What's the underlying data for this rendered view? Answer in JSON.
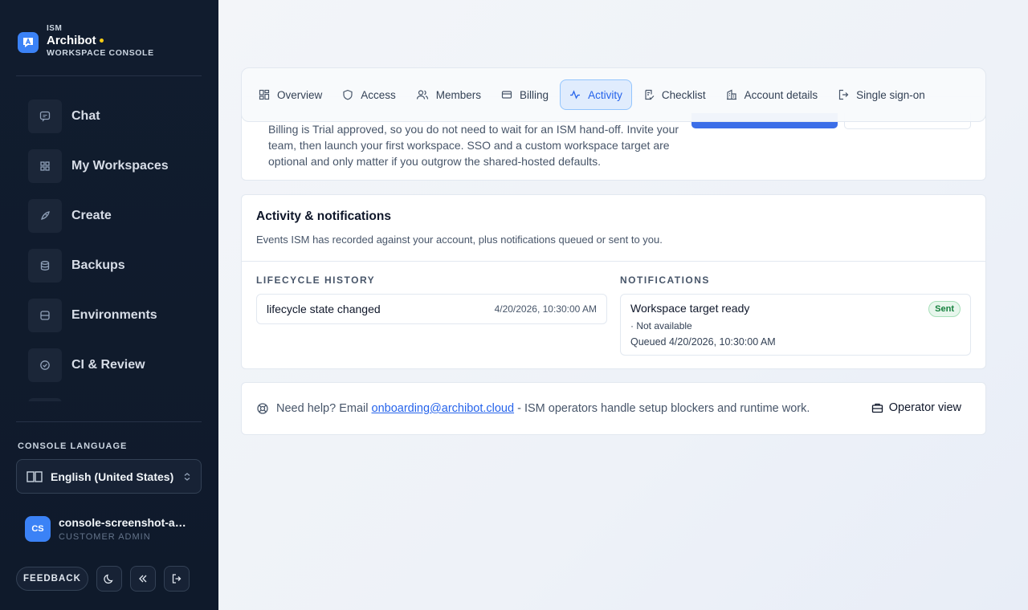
{
  "brand": {
    "org": "ISM",
    "name": "Archibot",
    "subtitle": "WORKSPACE CONSOLE",
    "accent_color": "#facc15"
  },
  "sidebar": {
    "items": [
      {
        "label": "Chat",
        "icon": "chat-icon"
      },
      {
        "label": "My Workspaces",
        "icon": "grid-icon"
      },
      {
        "label": "Create",
        "icon": "rocket-icon"
      },
      {
        "label": "Backups",
        "icon": "database-icon"
      },
      {
        "label": "Environments",
        "icon": "server-icon"
      },
      {
        "label": "CI & Review",
        "icon": "check-circle-icon"
      }
    ],
    "language_label": "CONSOLE LANGUAGE",
    "language_value": "English (United States)",
    "user": {
      "initials": "CS",
      "name": "console-screenshot-admin",
      "role": "CUSTOMER ADMIN"
    },
    "feedback_label": "FEEDBACK"
  },
  "tabs": [
    {
      "label": "Overview",
      "icon": "overview-icon",
      "active": false
    },
    {
      "label": "Access",
      "icon": "shield-icon",
      "active": false
    },
    {
      "label": "Members",
      "icon": "users-icon",
      "active": false
    },
    {
      "label": "Billing",
      "icon": "credit-card-icon",
      "active": false
    },
    {
      "label": "Activity",
      "icon": "activity-icon",
      "active": true
    },
    {
      "label": "Checklist",
      "icon": "checklist-icon",
      "active": false
    },
    {
      "label": "Account details",
      "icon": "building-icon",
      "active": false
    },
    {
      "label": "Single sign-on",
      "icon": "sign-in-icon",
      "active": false
    }
  ],
  "billing": {
    "text": "Billing is Trial approved, so you do not need to wait for an ISM hand-off. Invite your team, then launch your first workspace. SSO and a custom workspace target are optional and only matter if you outgrow the shared-hosted defaults."
  },
  "activity": {
    "title": "Activity & notifications",
    "description": "Events ISM has recorded against your account, plus notifications queued or sent to you.",
    "lifecycle_label": "LIFECYCLE HISTORY",
    "notifications_label": "NOTIFICATIONS",
    "lifecycle": [
      {
        "event": "lifecycle state changed",
        "time": "4/20/2026, 10:30:00 AM"
      }
    ],
    "notifications": [
      {
        "title": "Workspace target ready",
        "status": "Sent",
        "channel": "· Not available",
        "queued": "Queued 4/20/2026, 10:30:00 AM"
      }
    ]
  },
  "help": {
    "prefix": "Need help? Email",
    "email": "onboarding@archibot.cloud",
    "suffix": "- ISM operators handle setup blockers and runtime work.",
    "operator_label": "Operator view"
  }
}
